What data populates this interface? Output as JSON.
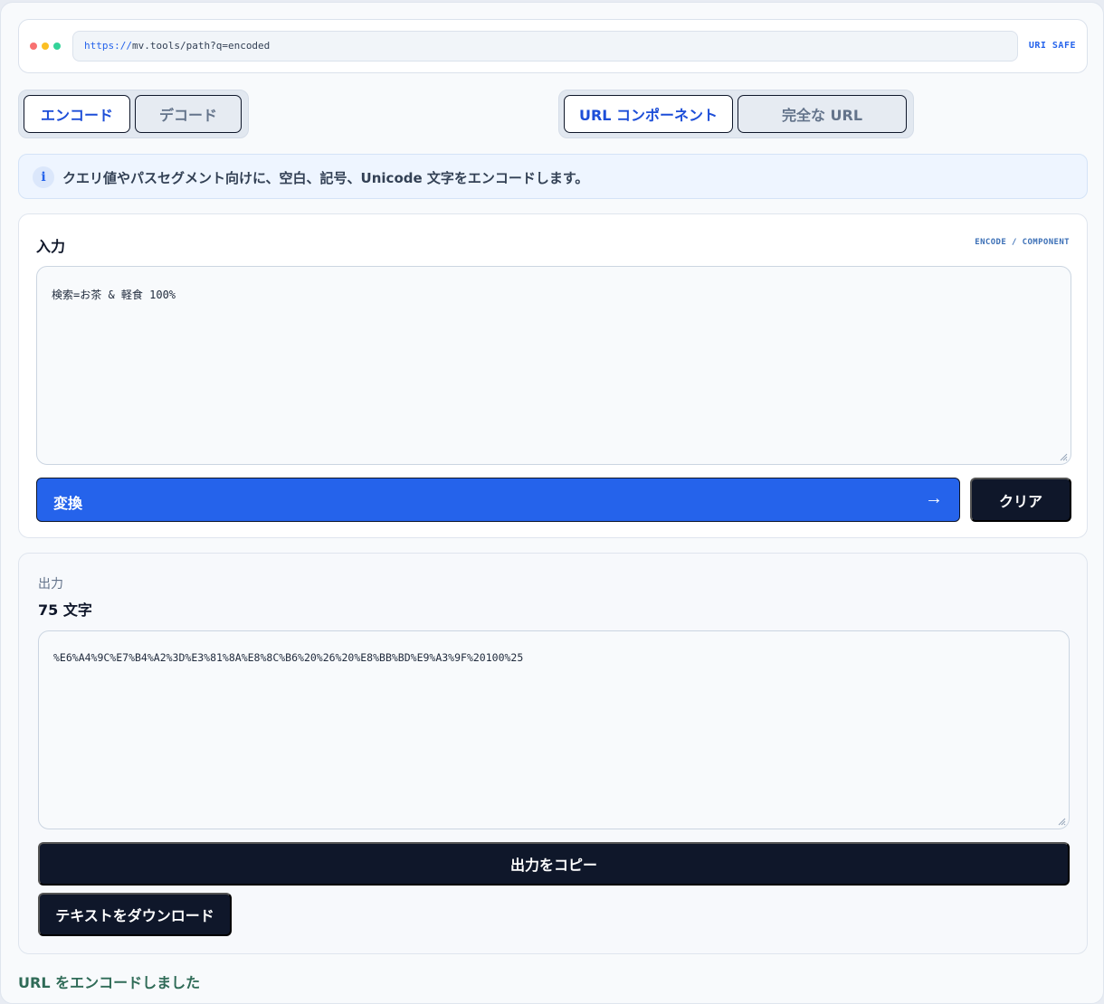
{
  "address_bar": {
    "scheme": "https://",
    "rest": "mv.tools/path?q=encoded",
    "badge": "URI SAFE"
  },
  "mode_toggle": {
    "encode_label": "エンコード",
    "decode_label": "デコード",
    "selected": "encode"
  },
  "scope_toggle": {
    "component_label": "URL コンポーネント",
    "full_label": "完全な URL",
    "selected": "component"
  },
  "info": {
    "icon": "info-icon",
    "text": "クエリ値やパスセグメント向けに、空白、記号、Unicode 文字をエンコードします。"
  },
  "input": {
    "title": "入力",
    "mode_tag": "ENCODE / COMPONENT",
    "value": "検索=お茶 & 軽食 100%",
    "convert_label": "変換",
    "convert_arrow": "→",
    "clear_label": "クリア"
  },
  "output": {
    "label": "出力",
    "count": "75 文字",
    "value": "%E6%A4%9C%E7%B4%A2%3D%E3%81%8A%E8%8C%B6%20%26%20%E8%BB%BD%E9%A3%9F%20100%25",
    "copy_label": "出力をコピー",
    "download_label": "テキストをダウンロード"
  },
  "status": "URL をエンコードしました",
  "colors": {
    "accent": "#2563eb",
    "dark": "#0f172a",
    "status": "#2f6b57"
  }
}
